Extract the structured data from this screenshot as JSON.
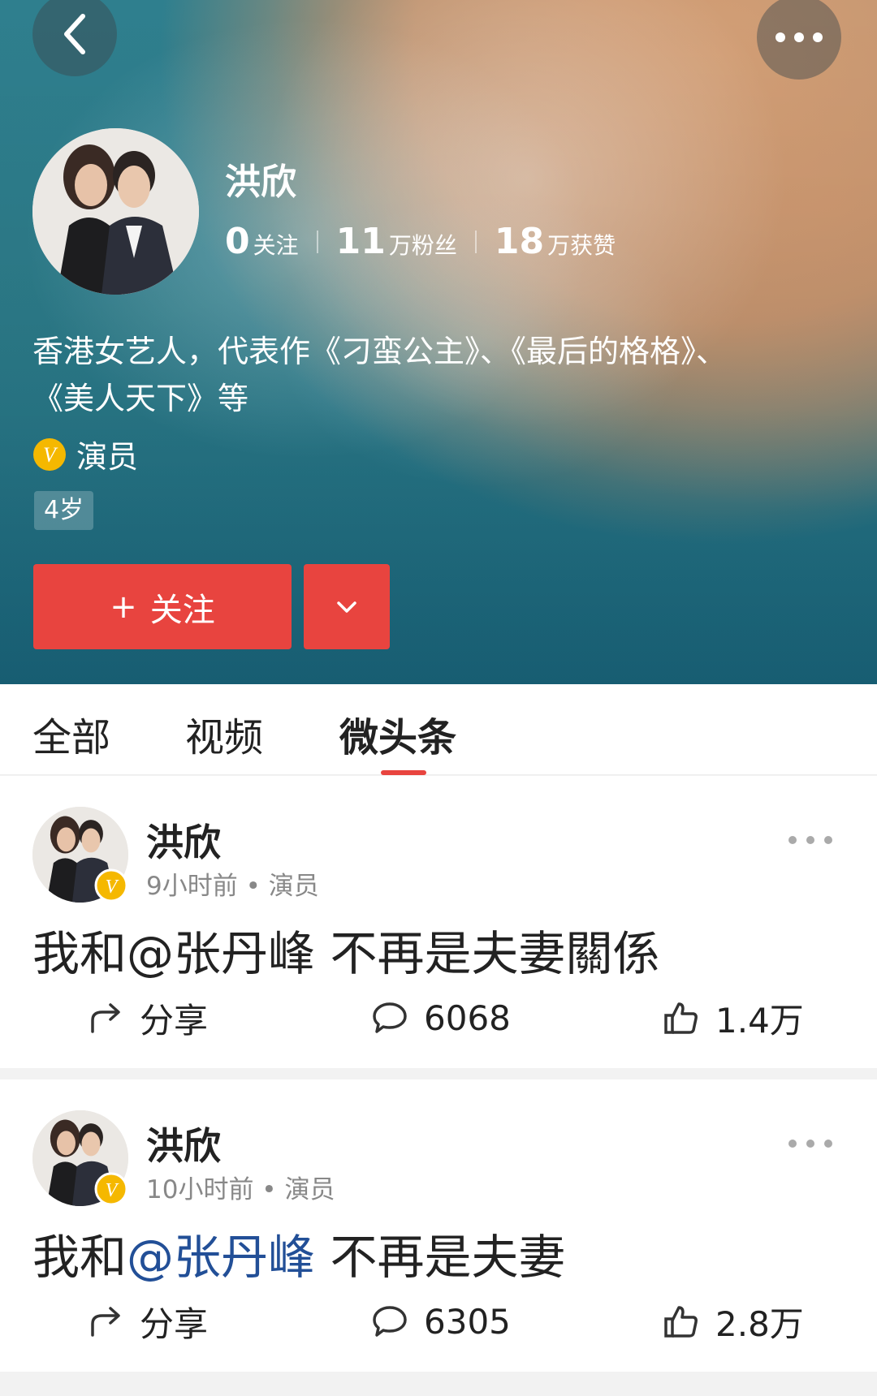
{
  "profile": {
    "name": "洪欣",
    "stats": [
      {
        "value": "0",
        "label": "关注"
      },
      {
        "value": "11",
        "label": "万粉丝"
      },
      {
        "value": "18",
        "label": "万获赞"
      }
    ],
    "bio_line1": "香港女艺人，代表作《刁蛮公主》、《最后的格格》、",
    "bio_line2": "《美人天下》等",
    "verification": "演员",
    "age_badge": "4岁",
    "follow_label": "关注"
  },
  "tabs": [
    {
      "label": "全部"
    },
    {
      "label": "视频"
    },
    {
      "label": "微头条"
    }
  ],
  "posts": [
    {
      "author": "洪欣",
      "meta": "9小时前 • 演员",
      "text_prefix": "我和",
      "mention": "@张丹峰",
      "text_suffix": " 不再是夫妻關係",
      "share_label": "分享",
      "comments": "6068",
      "likes": "1.4万"
    },
    {
      "author": "洪欣",
      "meta": "10小时前 • 演员",
      "text_prefix": "我和",
      "mention": "@张丹峰",
      "text_suffix": " 不再是夫妻",
      "share_label": "分享",
      "comments": "6305",
      "likes": "2.8万"
    }
  ],
  "colors": {
    "accent_red": "#e8443f",
    "mention_blue": "#224f97",
    "verify_gold": "#f5b800"
  },
  "icons": [
    "back-icon",
    "more-icon",
    "verified-icon",
    "chevron-down-icon",
    "share-icon",
    "comment-icon",
    "like-icon"
  ]
}
